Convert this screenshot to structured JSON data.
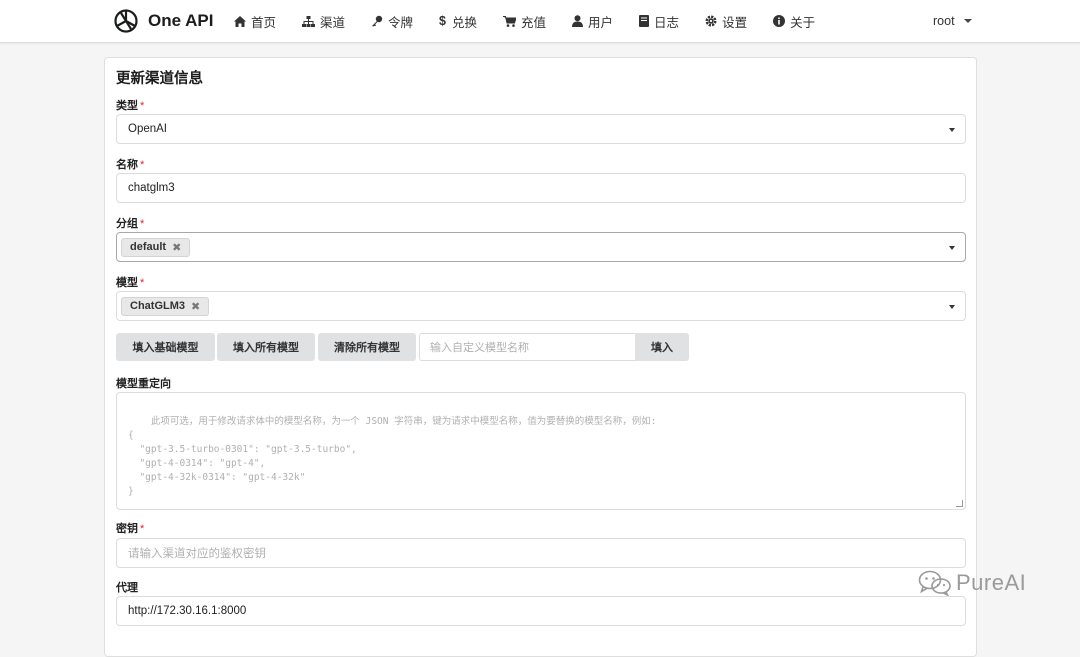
{
  "app": {
    "brand": "One API"
  },
  "nav": {
    "items": [
      {
        "label": "首页",
        "icon": "home-icon"
      },
      {
        "label": "渠道",
        "icon": "sitemap-icon"
      },
      {
        "label": "令牌",
        "icon": "key-icon"
      },
      {
        "label": "兑换",
        "icon": "dollar-icon"
      },
      {
        "label": "充值",
        "icon": "cart-icon"
      },
      {
        "label": "用户",
        "icon": "user-icon"
      },
      {
        "label": "日志",
        "icon": "book-icon"
      },
      {
        "label": "设置",
        "icon": "gear-icon"
      },
      {
        "label": "关于",
        "icon": "info-icon"
      }
    ],
    "user": "root"
  },
  "form": {
    "title": "更新渠道信息",
    "type": {
      "label": "类型",
      "value": "OpenAI"
    },
    "name": {
      "label": "名称",
      "value": "chatglm3"
    },
    "group": {
      "label": "分组",
      "tag": "default"
    },
    "model": {
      "label": "模型",
      "tag": "ChatGLM3"
    },
    "buttons": {
      "fill_basic": "填入基础模型",
      "fill_all": "填入所有模型",
      "clear_all": "清除所有模型",
      "custom_placeholder": "输入自定义模型名称",
      "fill": "填入"
    },
    "mapping": {
      "label": "模型重定向",
      "placeholder": "此项可选，用于修改请求体中的模型名称，为一个 JSON 字符串，键为请求中模型名称，值为要替换的模型名称，例如:\n{\n  \"gpt-3.5-turbo-0301\": \"gpt-3.5-turbo\",\n  \"gpt-4-0314\": \"gpt-4\",\n  \"gpt-4-32k-0314\": \"gpt-4-32k\"\n}"
    },
    "key": {
      "label": "密钥",
      "placeholder": "请输入渠道对应的鉴权密钥"
    },
    "proxy": {
      "label": "代理",
      "value": "http://172.30.16.1:8000"
    }
  },
  "watermark": {
    "text": "PureAI"
  },
  "colors": {
    "required": "#db2828",
    "button_bg": "#e0e1e2"
  }
}
